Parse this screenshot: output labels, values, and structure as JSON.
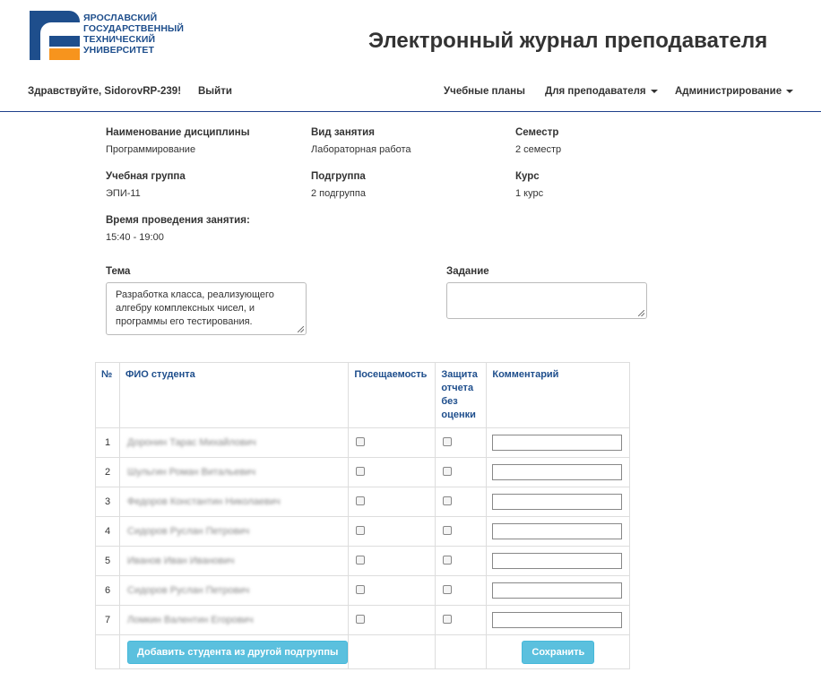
{
  "header": {
    "logo_lines": [
      "ЯРОСЛАВСКИЙ",
      "ГОСУДАРСТВЕННЫЙ",
      "ТЕХНИЧЕСКИЙ",
      "УНИВЕРСИТЕТ"
    ],
    "app_title": "Электронный журнал преподавателя"
  },
  "nav": {
    "greeting": "Здравствуйте, SidorovRP-239!",
    "logout": "Выйти",
    "plans": "Учебные планы",
    "for_teachers": "Для преподавателя",
    "admin": "Администрирование"
  },
  "lesson": {
    "discipline_label": "Наименование дисциплины",
    "discipline": "Программирование",
    "type_label": "Вид занятия",
    "type": "Лабораторная работа",
    "semester_label": "Семестр",
    "semester": "2 семестр",
    "group_label": "Учебная группа",
    "group": "ЭПИ-11",
    "subgroup_label": "Подгруппа",
    "subgroup": "2 подгруппа",
    "course_label": "Курс",
    "course": "1 курс",
    "time_label": "Время проведения занятия:",
    "time": "15:40 - 19:00",
    "topic_label": "Тема",
    "topic": "Разработка класса, реализующего алгебру комплексных чисел, и программы его тестирования.",
    "task_label": "Задание",
    "task": ""
  },
  "table": {
    "headers": {
      "num": "№",
      "fio": "ФИО студента",
      "attendance": "Посещаемость",
      "defense": "Защита отчета без оценки",
      "comment": "Комментарий"
    },
    "rows": [
      {
        "num": "1",
        "fio": "Доронин Тарас Михайлович"
      },
      {
        "num": "2",
        "fio": "Шульгин Роман Витальевич"
      },
      {
        "num": "3",
        "fio": "Федоров Константин Николаевич"
      },
      {
        "num": "4",
        "fio": "Сидоров Руслан Петрович"
      },
      {
        "num": "5",
        "fio": "Иванов Иван Иванович"
      },
      {
        "num": "6",
        "fio": "Сидоров Руслан Петрович"
      },
      {
        "num": "7",
        "fio": "Ломкин Валентин Егорович"
      }
    ],
    "add_button": "Добавить студента из другой подгруппы",
    "save_button": "Сохранить"
  },
  "colors": {
    "brand_blue": "#1e4e8c",
    "brand_orange": "#f7941d",
    "button": "#5bc0de"
  }
}
